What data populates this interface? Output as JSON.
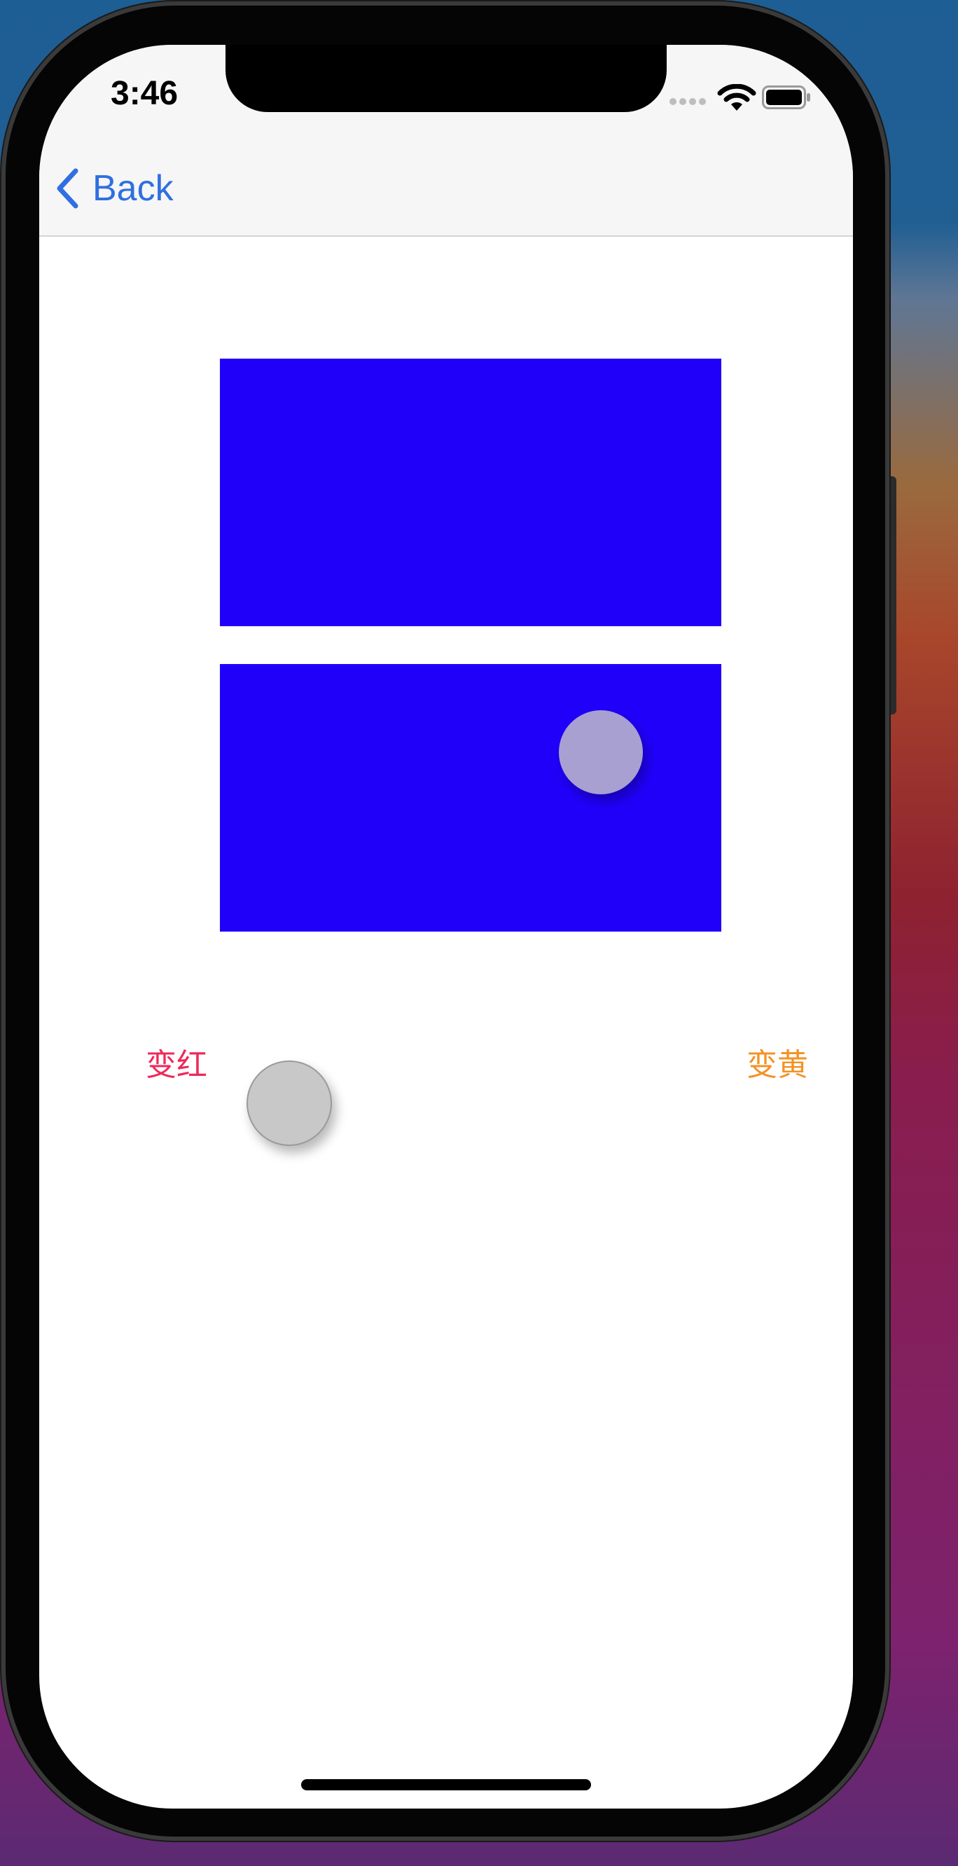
{
  "status_bar": {
    "time": "3:46",
    "signal_icon": "signal-dots-icon",
    "wifi_icon": "wifi-icon",
    "battery_icon": "battery-icon"
  },
  "nav": {
    "back_label": "Back",
    "back_icon": "chevron-left-icon"
  },
  "buttons": {
    "red_label": "变红",
    "yellow_label": "变黄"
  },
  "colors": {
    "accent_blue": "#2f6fe0",
    "rect_blue": "#2100fa",
    "red_label": "#f0285a",
    "yellow_label": "#f39325"
  }
}
